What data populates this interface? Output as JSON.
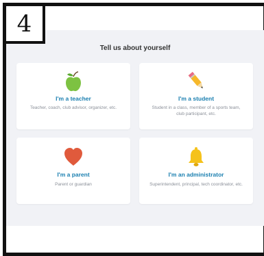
{
  "step_badge": "4",
  "heading": "Tell us about yourself",
  "cards": {
    "teacher": {
      "title": "I'm a teacher",
      "description": "Teacher, coach, club advisor, organizer, etc."
    },
    "student": {
      "title": "I'm a student",
      "description": "Student in a class, member of a sports team, club participant, etc."
    },
    "parent": {
      "title": "I'm a parent",
      "description": "Parent or guardian"
    },
    "admin": {
      "title": "I'm an administrator",
      "description": "Superintendent, principal, tech coordinator, etc."
    }
  },
  "icons": {
    "teacher": "apple-icon",
    "student": "pencil-icon",
    "parent": "heart-icon",
    "admin": "bell-icon"
  },
  "colors": {
    "title": "#1a7fb0",
    "apple": "#7dc242",
    "pencil": "#f6b82a",
    "heart": "#e05a3c",
    "bell": "#f5c21b"
  }
}
